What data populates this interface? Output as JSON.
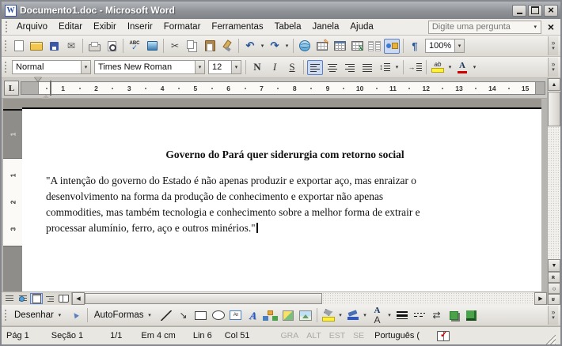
{
  "window": {
    "title": "Documento1.doc - Microsoft Word"
  },
  "menu": {
    "items": [
      "Arquivo",
      "Editar",
      "Exibir",
      "Inserir",
      "Formatar",
      "Ferramentas",
      "Tabela",
      "Janela",
      "Ajuda"
    ],
    "question_placeholder": "Digite uma pergunta"
  },
  "standard_toolbar": {
    "items": [
      {
        "t": "i",
        "n": "new-document"
      },
      {
        "t": "i",
        "n": "open-folder"
      },
      {
        "t": "i",
        "n": "save"
      },
      {
        "t": "i",
        "n": "email"
      },
      {
        "t": "s"
      },
      {
        "t": "i",
        "n": "print"
      },
      {
        "t": "i",
        "n": "print-preview"
      },
      {
        "t": "s"
      },
      {
        "t": "i",
        "n": "spelling"
      },
      {
        "t": "i",
        "n": "research"
      },
      {
        "t": "s"
      },
      {
        "t": "i",
        "n": "cut",
        "g": "✂"
      },
      {
        "t": "i",
        "n": "copy"
      },
      {
        "t": "i",
        "n": "paste"
      },
      {
        "t": "i",
        "n": "format-painter"
      },
      {
        "t": "s"
      },
      {
        "t": "i",
        "n": "undo",
        "g": "↶",
        "dd": true
      },
      {
        "t": "i",
        "n": "redo",
        "g": "↷",
        "dd": true
      },
      {
        "t": "s"
      },
      {
        "t": "i",
        "n": "insert-hyperlink"
      },
      {
        "t": "i",
        "n": "tables-and-borders"
      },
      {
        "t": "i",
        "n": "insert-table"
      },
      {
        "t": "i",
        "n": "insert-excel"
      },
      {
        "t": "i",
        "n": "columns"
      },
      {
        "t": "i",
        "n": "drawing",
        "active": true
      },
      {
        "t": "s"
      },
      {
        "t": "i",
        "n": "show-hide",
        "g": "¶"
      },
      {
        "t": "combo",
        "n": "zoom",
        "v": "100%",
        "w": 50
      }
    ]
  },
  "formatting_toolbar": {
    "style": "Normal",
    "font": "Times New Roman",
    "size": "12",
    "items": [
      {
        "t": "i",
        "n": "bold",
        "g": "N"
      },
      {
        "t": "i",
        "n": "italic",
        "g": "I"
      },
      {
        "t": "i",
        "n": "underline",
        "g": "S"
      },
      {
        "t": "s"
      },
      {
        "t": "i",
        "n": "align-left",
        "active": true
      },
      {
        "t": "i",
        "n": "align-center"
      },
      {
        "t": "i",
        "n": "align-right"
      },
      {
        "t": "i",
        "n": "justify"
      },
      {
        "t": "i",
        "n": "line-spacing",
        "dd": true
      },
      {
        "t": "s"
      },
      {
        "t": "i",
        "n": "increase-indent"
      },
      {
        "t": "s"
      },
      {
        "t": "i",
        "n": "highlight",
        "dd": true
      },
      {
        "t": "i",
        "n": "font-color",
        "dd": true
      }
    ]
  },
  "ruler": {
    "numbers": [
      "1",
      "2",
      "3",
      "4",
      "5",
      "6",
      "7",
      "8",
      "9",
      "10",
      "11",
      "12",
      "13",
      "14",
      "15"
    ]
  },
  "vertical_ruler": {
    "margin_numbers": [
      "1"
    ],
    "numbers": [
      "1",
      "2",
      "3"
    ]
  },
  "document": {
    "title": "Governo do Pará quer siderurgia com retorno social",
    "lines": [
      "\"A intenção do governo do Estado é não apenas produzir e exportar aço, mas enraizar o",
      "desenvolvimento na forma da produção de conhecimento e exportar não apenas",
      "commodities, mas também tecnologia e conhecimento sobre a melhor forma de extrair e",
      "processar alumínio, ferro, aço e outros minérios.\""
    ]
  },
  "view_buttons": [
    {
      "n": "normal-view",
      "cls": "normal"
    },
    {
      "n": "web-layout-view",
      "cls": "web"
    },
    {
      "n": "print-layout-view",
      "cls": "print",
      "active": true
    },
    {
      "n": "outline-view",
      "cls": "outline"
    },
    {
      "n": "reading-layout-view",
      "cls": "reading"
    }
  ],
  "drawing_toolbar": {
    "items": [
      {
        "t": "label",
        "n": "draw-menu",
        "label": "Desenhar",
        "dd": true
      },
      {
        "t": "i",
        "n": "select-objects"
      },
      {
        "t": "s"
      },
      {
        "t": "label",
        "n": "autoshapes-menu",
        "label": "AutoFormas",
        "dd": true
      },
      {
        "t": "i",
        "n": "line"
      },
      {
        "t": "i",
        "n": "arrow",
        "g": "↘"
      },
      {
        "t": "i",
        "n": "rectangle"
      },
      {
        "t": "i",
        "n": "oval"
      },
      {
        "t": "i",
        "n": "text-box"
      },
      {
        "t": "i",
        "n": "wordart",
        "g": "A"
      },
      {
        "t": "i",
        "n": "diagram"
      },
      {
        "t": "i",
        "n": "clip-art"
      },
      {
        "t": "i",
        "n": "picture"
      },
      {
        "t": "s"
      },
      {
        "t": "i",
        "n": "fill-color",
        "dd": true
      },
      {
        "t": "i",
        "n": "line-color",
        "dd": true
      },
      {
        "t": "i",
        "n": "draw-font-color",
        "g": "A",
        "dd": true
      },
      {
        "t": "i",
        "n": "line-style"
      },
      {
        "t": "i",
        "n": "dash-style"
      },
      {
        "t": "i",
        "n": "arrow-style",
        "g": "⇄"
      },
      {
        "t": "i",
        "n": "shadow-style"
      },
      {
        "t": "i",
        "n": "threed-style"
      }
    ]
  },
  "status_bar": {
    "page": "Pág 1",
    "section": "Seção 1",
    "page_of": "1/1",
    "at": "Em 4 cm",
    "line": "Lin 6",
    "column": "Col 51",
    "toggles": [
      "GRA",
      "ALT",
      "EST",
      "SE"
    ],
    "language": "Português ("
  },
  "colors": {
    "active_border": "#5b7fc4",
    "highlight_yellow": "#ffef3e",
    "font_color_bar": "#cc0000",
    "titlebar_gray": "#8f9296",
    "page_white": "#ffffff"
  }
}
